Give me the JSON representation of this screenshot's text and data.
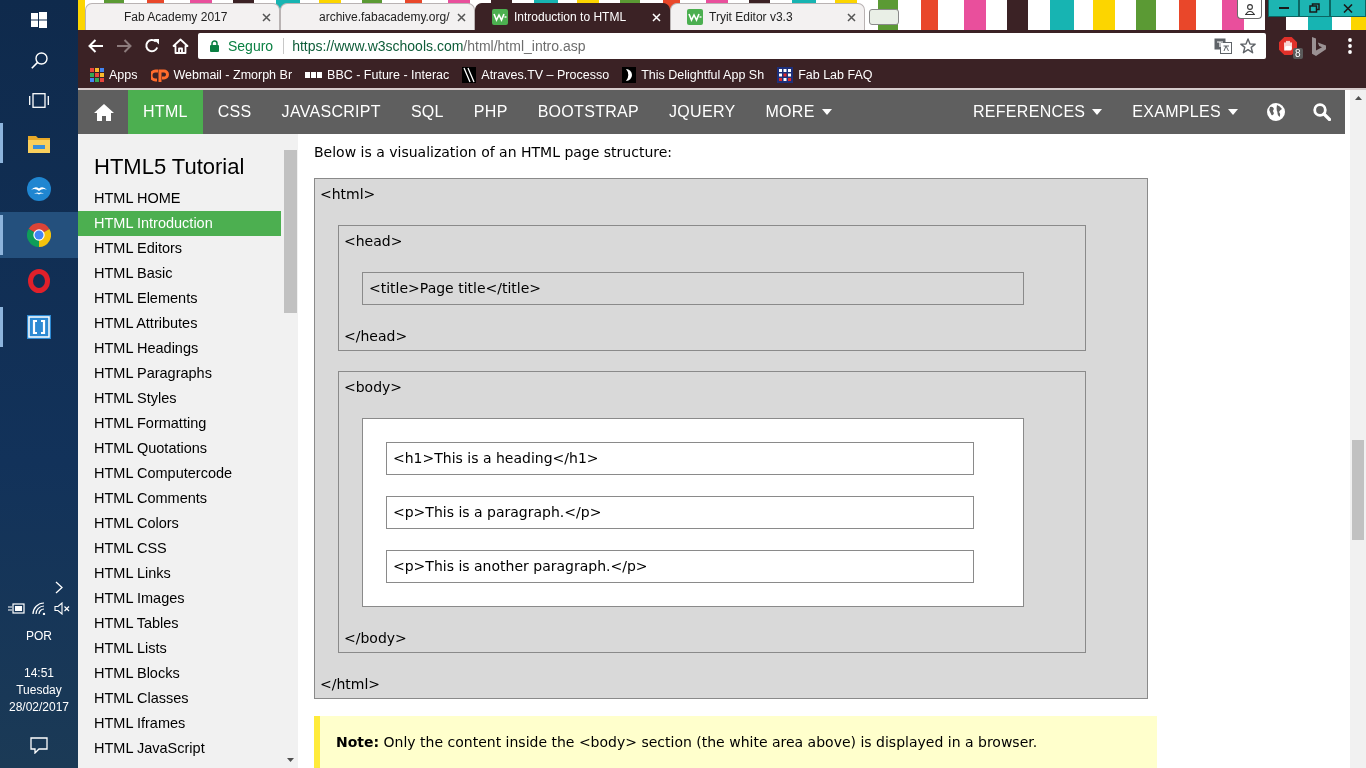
{
  "taskbar": {
    "apps": [
      {
        "kind": "folder",
        "running": true,
        "selected": false
      },
      {
        "kind": "bird",
        "running": false,
        "selected": false
      },
      {
        "kind": "circle-logo",
        "running": true,
        "selected": true
      },
      {
        "kind": "ring",
        "running": false,
        "selected": false
      },
      {
        "kind": "bracket",
        "running": true,
        "selected": false
      }
    ],
    "language": "POR",
    "time": "14:51",
    "day": "Tuesday",
    "date": "28/02/2017"
  },
  "browser": {
    "tabs": [
      {
        "title": "Fab Academy 2017",
        "favicon": false,
        "selected": false
      },
      {
        "title": "archive.fabacademy.org/",
        "favicon": false,
        "selected": false
      },
      {
        "title": "Introduction to HTML",
        "favicon": true,
        "selected": true
      },
      {
        "title": "Tryit Editor v3.3",
        "favicon": true,
        "selected": false
      }
    ],
    "nav_buttons": [
      {
        "kind": "back",
        "disabled": false
      },
      {
        "kind": "forward",
        "disabled": true
      },
      {
        "kind": "reload",
        "disabled": false
      },
      {
        "kind": "home",
        "disabled": false
      }
    ],
    "address_bar": {
      "security_label": "Seguro",
      "url_origin": "https://www.w3schools.com",
      "url_path": "/html/html_intro.asp"
    },
    "extensions": [
      {
        "kind": "stop-hand",
        "badge": "8"
      },
      {
        "kind": "ribbon"
      }
    ],
    "bookmarks": [
      {
        "kind": "apps-grid",
        "label": "Apps"
      },
      {
        "kind": "swirl",
        "label": "Webmail - Zmorph Br"
      },
      {
        "kind": "boxes",
        "label": "BBC - Future - Interac"
      },
      {
        "kind": "slashes",
        "label": "Atraves.TV – Processo"
      },
      {
        "kind": "crescent",
        "label": "This Delightful App Sh"
      },
      {
        "kind": "grid",
        "label": "Fab Lab FAQ"
      }
    ]
  },
  "site_nav": {
    "left": [
      {
        "kind": "home",
        "selected": false
      },
      {
        "kind": "link",
        "label": "HTML",
        "selected": true
      },
      {
        "kind": "link",
        "label": "CSS",
        "selected": false
      },
      {
        "kind": "link",
        "label": "JAVASCRIPT",
        "selected": false
      },
      {
        "kind": "link",
        "label": "SQL",
        "selected": false
      },
      {
        "kind": "link",
        "label": "PHP",
        "selected": false
      },
      {
        "kind": "link",
        "label": "BOOTSTRAP",
        "selected": false
      },
      {
        "kind": "link",
        "label": "JQUERY",
        "selected": false
      },
      {
        "kind": "menu",
        "label": "MORE",
        "selected": false
      }
    ],
    "right": [
      {
        "kind": "menu",
        "label": "REFERENCES"
      },
      {
        "kind": "menu",
        "label": "EXAMPLES"
      },
      {
        "kind": "globe"
      },
      {
        "kind": "search"
      }
    ]
  },
  "sidebar": {
    "title": "HTML5 Tutorial",
    "items": [
      {
        "label": "HTML HOME",
        "selected": false
      },
      {
        "label": "HTML Introduction",
        "selected": true
      },
      {
        "label": "HTML Editors",
        "selected": false
      },
      {
        "label": "HTML Basic",
        "selected": false
      },
      {
        "label": "HTML Elements",
        "selected": false
      },
      {
        "label": "HTML Attributes",
        "selected": false
      },
      {
        "label": "HTML Headings",
        "selected": false
      },
      {
        "label": "HTML Paragraphs",
        "selected": false
      },
      {
        "label": "HTML Styles",
        "selected": false
      },
      {
        "label": "HTML Formatting",
        "selected": false
      },
      {
        "label": "HTML Quotations",
        "selected": false
      },
      {
        "label": "HTML Computercode",
        "selected": false
      },
      {
        "label": "HTML Comments",
        "selected": false
      },
      {
        "label": "HTML Colors",
        "selected": false
      },
      {
        "label": "HTML CSS",
        "selected": false
      },
      {
        "label": "HTML Links",
        "selected": false
      },
      {
        "label": "HTML Images",
        "selected": false
      },
      {
        "label": "HTML Tables",
        "selected": false
      },
      {
        "label": "HTML Lists",
        "selected": false
      },
      {
        "label": "HTML Blocks",
        "selected": false
      },
      {
        "label": "HTML Classes",
        "selected": false
      },
      {
        "label": "HTML Iframes",
        "selected": false
      },
      {
        "label": "HTML JavaScript",
        "selected": false
      }
    ]
  },
  "content": {
    "intro": "Below is a visualization of an HTML page structure:",
    "structure": {
      "kind": "element",
      "open": "<html>",
      "close": "</html>",
      "children": [
        {
          "kind": "element",
          "open": "<head>",
          "close": "</head>",
          "children": [
            {
              "kind": "line",
              "text": "<title>Page title</title>"
            }
          ]
        },
        {
          "kind": "element",
          "open": "<body>",
          "close": "</body>",
          "children": [
            {
              "kind": "viewport",
              "children": [
                {
                  "kind": "line",
                  "text": "<h1>This is a heading</h1>"
                },
                {
                  "kind": "line",
                  "text": "<p>This is a paragraph.</p>"
                },
                {
                  "kind": "line",
                  "text": "<p>This is another paragraph.</p>"
                }
              ]
            }
          ]
        }
      ]
    },
    "note": "**Note:** Only the content inside the <body> section (the white area above) is displayed in a browser."
  }
}
